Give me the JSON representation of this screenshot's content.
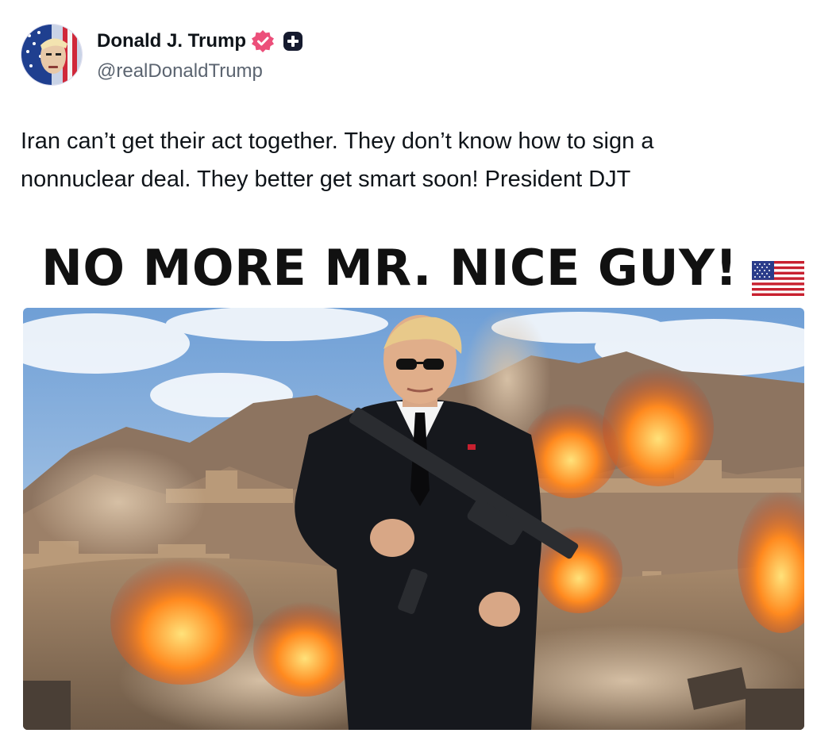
{
  "author": {
    "display_name": "Donald J. Trump",
    "handle": "@realDonaldTrump",
    "verified_icon": "verified-badge-icon",
    "plus_icon": "plus-badge-icon",
    "verified_color": "#ec4f7a"
  },
  "post": {
    "text_line_1": "Iran can’t get their act together. They don’t know how to sign a",
    "text_line_2": "nonnuclear deal. They better get smart soon! President DJT"
  },
  "media": {
    "headline": "NO MORE MR. NICE GUY!",
    "headline_icon": "us-flag-icon"
  }
}
